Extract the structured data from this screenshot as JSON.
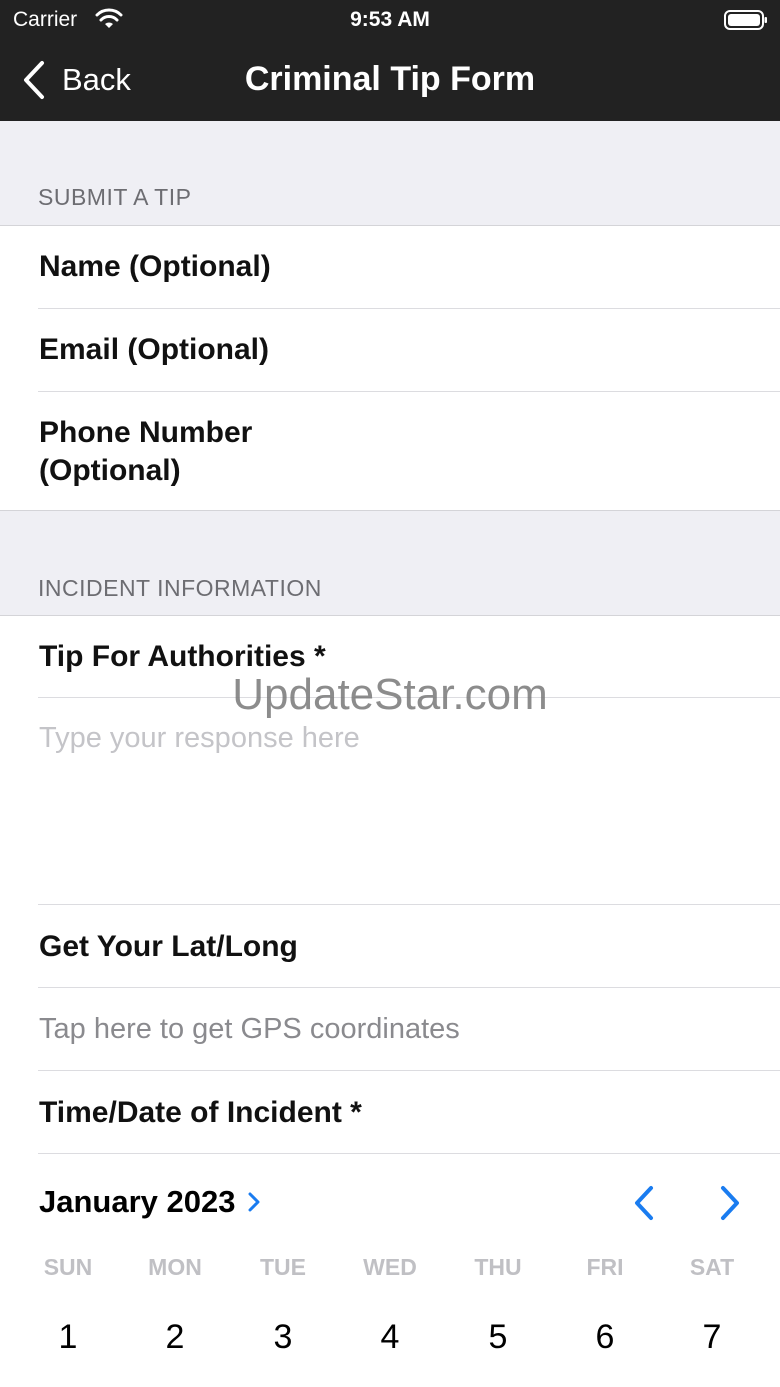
{
  "status_bar": {
    "carrier": "Carrier",
    "time": "9:53 AM"
  },
  "nav": {
    "back_label": "Back",
    "title": "Criminal Tip Form"
  },
  "sections": {
    "submit": {
      "title": "SUBMIT A TIP",
      "name_label": "Name (Optional)",
      "email_label": "Email (Optional)",
      "phone_label_line1": "Phone Number",
      "phone_label_line2": "(Optional)"
    },
    "incident": {
      "title": "INCIDENT INFORMATION",
      "tip_label": "Tip For Authorities *",
      "tip_placeholder": "Type your response here",
      "latlong_label": "Get Your Lat/Long",
      "gps_action": "Tap here to get GPS coordinates",
      "datetime_label": "Time/Date of Incident *"
    }
  },
  "watermark": "UpdateStar.com",
  "calendar": {
    "month_label": "January 2023",
    "weekdays": [
      "SUN",
      "MON",
      "TUE",
      "WED",
      "THU",
      "FRI",
      "SAT"
    ],
    "days": [
      "1",
      "2",
      "3",
      "4",
      "5",
      "6",
      "7"
    ]
  },
  "colors": {
    "accent": "#1a7cf0",
    "header_bg": "#222222",
    "section_bg": "#efeff4"
  },
  "icons": [
    "wifi-icon",
    "battery-icon",
    "chevron-left-icon",
    "chevron-right-icon"
  ]
}
